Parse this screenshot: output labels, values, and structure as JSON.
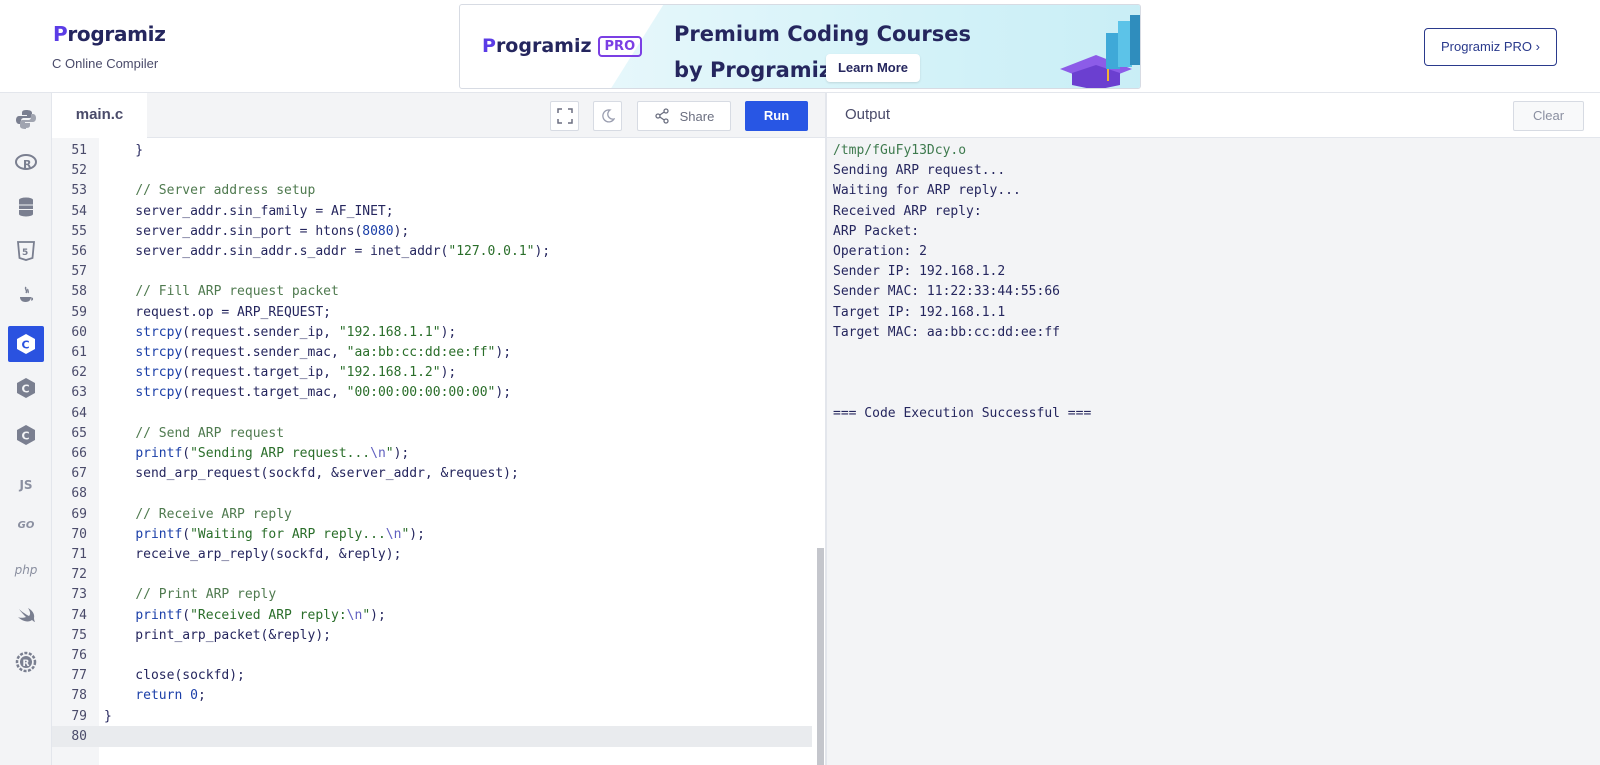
{
  "header": {
    "logo_initial": "P",
    "logo_rest": "rogramiz",
    "subtitle": "C Online Compiler",
    "pro_button": "Programiz PRO ›"
  },
  "banner": {
    "logo_initial": "P",
    "logo_rest": "rogramiz",
    "pro_badge": "PRO",
    "title_line1": "Premium Coding Courses",
    "title_line2": "by Programiz",
    "cta": "Learn More"
  },
  "sidebar": {
    "languages": [
      {
        "name": "python",
        "icon": "python-icon",
        "active": false
      },
      {
        "name": "r",
        "icon": "r-icon",
        "active": false
      },
      {
        "name": "sql",
        "icon": "database-icon",
        "active": false
      },
      {
        "name": "html",
        "icon": "html5-icon",
        "active": false
      },
      {
        "name": "java",
        "icon": "java-icon",
        "active": false
      },
      {
        "name": "c",
        "icon": "c-icon",
        "active": true
      },
      {
        "name": "cpp",
        "icon": "cpp-icon",
        "active": false
      },
      {
        "name": "csharp",
        "icon": "csharp-icon",
        "active": false
      },
      {
        "name": "javascript",
        "label": "JS",
        "icon": "js-icon",
        "active": false
      },
      {
        "name": "go",
        "label": "GO",
        "icon": "go-icon",
        "active": false
      },
      {
        "name": "php",
        "label": "php",
        "icon": "php-icon",
        "active": false
      },
      {
        "name": "swift",
        "icon": "swift-icon",
        "active": false
      },
      {
        "name": "rust",
        "icon": "rust-icon",
        "active": false
      }
    ]
  },
  "editor": {
    "file_tab": "main.c",
    "share_label": "Share",
    "run_label": "Run",
    "lines": [
      {
        "n": "51",
        "code": "    }"
      },
      {
        "n": "52",
        "code": ""
      },
      {
        "n": "53",
        "code": "    // Server address setup"
      },
      {
        "n": "54",
        "code": "    server_addr.sin_family = AF_INET;"
      },
      {
        "n": "55",
        "code": "    server_addr.sin_port = htons(8080);"
      },
      {
        "n": "56",
        "code": "    server_addr.sin_addr.s_addr = inet_addr(\"127.0.0.1\");"
      },
      {
        "n": "57",
        "code": ""
      },
      {
        "n": "58",
        "code": "    // Fill ARP request packet"
      },
      {
        "n": "59",
        "code": "    request.op = ARP_REQUEST;"
      },
      {
        "n": "60",
        "code": "    strcpy(request.sender_ip, \"192.168.1.1\");"
      },
      {
        "n": "61",
        "code": "    strcpy(request.sender_mac, \"aa:bb:cc:dd:ee:ff\");"
      },
      {
        "n": "62",
        "code": "    strcpy(request.target_ip, \"192.168.1.2\");"
      },
      {
        "n": "63",
        "code": "    strcpy(request.target_mac, \"00:00:00:00:00:00\");"
      },
      {
        "n": "64",
        "code": ""
      },
      {
        "n": "65",
        "code": "    // Send ARP request"
      },
      {
        "n": "66",
        "code": "    printf(\"Sending ARP request...\\n\");"
      },
      {
        "n": "67",
        "code": "    send_arp_request(sockfd, &server_addr, &request);"
      },
      {
        "n": "68",
        "code": ""
      },
      {
        "n": "69",
        "code": "    // Receive ARP reply"
      },
      {
        "n": "70",
        "code": "    printf(\"Waiting for ARP reply...\\n\");"
      },
      {
        "n": "71",
        "code": "    receive_arp_reply(sockfd, &reply);"
      },
      {
        "n": "72",
        "code": ""
      },
      {
        "n": "73",
        "code": "    // Print ARP reply"
      },
      {
        "n": "74",
        "code": "    printf(\"Received ARP reply:\\n\");"
      },
      {
        "n": "75",
        "code": "    print_arp_packet(&reply);"
      },
      {
        "n": "76",
        "code": ""
      },
      {
        "n": "77",
        "code": "    close(sockfd);"
      },
      {
        "n": "78",
        "code": "    return 0;"
      },
      {
        "n": "79",
        "code": "}"
      },
      {
        "n": "80",
        "code": ""
      }
    ]
  },
  "output": {
    "title": "Output",
    "clear_label": "Clear",
    "lines": [
      "/tmp/fGuFy13Dcy.o",
      "Sending ARP request...",
      "Waiting for ARP reply...",
      "Received ARP reply:",
      "ARP Packet:",
      "Operation: 2",
      "Sender IP: 192.168.1.2",
      "Sender MAC: 11:22:33:44:55:66",
      "Target IP: 192.168.1.1",
      "Target MAC: aa:bb:cc:dd:ee:ff",
      "",
      "",
      "",
      "=== Code Execution Successful ==="
    ]
  },
  "colors": {
    "accent": "#2856e4",
    "brand_purple": "#5b3ce6",
    "text_dark": "#25265e"
  }
}
